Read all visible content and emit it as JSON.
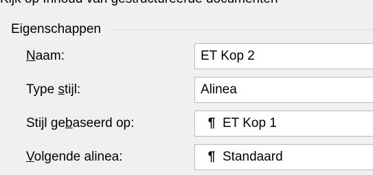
{
  "clipped_top_text": "Kijk op Inhoud van gestructureerde documenten",
  "group": {
    "title": "Eigenschappen"
  },
  "rows": [
    {
      "label_accel": "N",
      "label_rest": "aam:",
      "value": "ET Kop 2",
      "icon": null
    },
    {
      "label_pre": "Type ",
      "label_accel": "s",
      "label_rest": "tijl:",
      "value": "Alinea",
      "icon": null
    },
    {
      "label_pre": "Stijl ge",
      "label_accel": "b",
      "label_rest": "aseerd op:",
      "value": "ET Kop 1",
      "icon": "pilcrow-icon"
    },
    {
      "label_accel": "V",
      "label_rest": "olgende alinea:",
      "value": "Standaard",
      "icon": "pilcrow-icon"
    }
  ],
  "glyphs": {
    "pilcrow": "¶"
  }
}
